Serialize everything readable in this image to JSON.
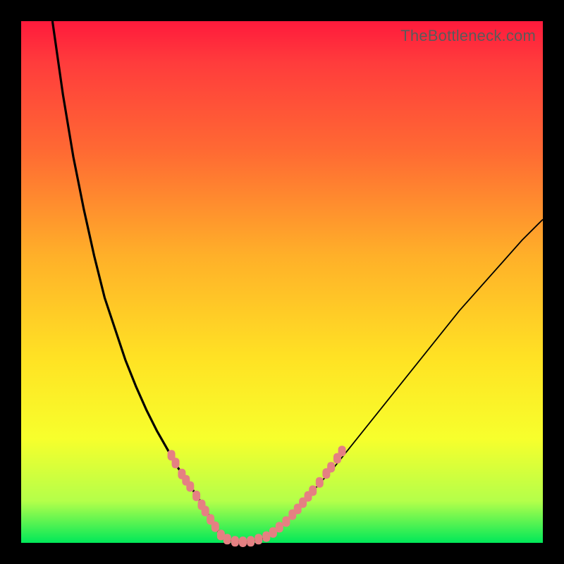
{
  "watermark": "TheBottleneck.com",
  "chart_data": {
    "type": "line",
    "title": "",
    "xlabel": "",
    "ylabel": "",
    "xlim": [
      0,
      100
    ],
    "ylim": [
      0,
      100
    ],
    "series": [
      {
        "name": "left-curve",
        "x": [
          6,
          8,
          10,
          12,
          14,
          16,
          18,
          20,
          22,
          24,
          26,
          28,
          30,
          32,
          34,
          35.5,
          37,
          38.5
        ],
        "y": [
          100,
          86,
          74,
          64,
          55,
          47,
          41,
          35,
          30,
          25.5,
          21.5,
          18,
          14.5,
          11.5,
          8.5,
          6,
          3.5,
          1
        ]
      },
      {
        "name": "valley-floor",
        "x": [
          38.5,
          40,
          42,
          44,
          46,
          47.5
        ],
        "y": [
          1,
          0.4,
          0.2,
          0.3,
          0.7,
          1.4
        ]
      },
      {
        "name": "right-curve",
        "x": [
          47.5,
          50,
          53,
          56,
          60,
          64,
          68,
          72,
          76,
          80,
          84,
          88,
          92,
          96,
          100
        ],
        "y": [
          1.4,
          3.5,
          6.5,
          10,
          14.5,
          19.5,
          24.5,
          29.5,
          34.5,
          39.5,
          44.5,
          49,
          53.5,
          58,
          62
        ]
      }
    ],
    "dot_overlay": {
      "name": "pink-dots",
      "color": "#e58082",
      "points": [
        {
          "x": 28.8,
          "y": 16.8
        },
        {
          "x": 29.6,
          "y": 15.3
        },
        {
          "x": 30.8,
          "y": 13.2
        },
        {
          "x": 31.6,
          "y": 12.0
        },
        {
          "x": 32.4,
          "y": 10.8
        },
        {
          "x": 33.6,
          "y": 9.0
        },
        {
          "x": 34.6,
          "y": 7.3
        },
        {
          "x": 35.3,
          "y": 6.1
        },
        {
          "x": 36.3,
          "y": 4.5
        },
        {
          "x": 37.2,
          "y": 3.1
        },
        {
          "x": 38.3,
          "y": 1.5
        },
        {
          "x": 39.5,
          "y": 0.7
        },
        {
          "x": 41.0,
          "y": 0.3
        },
        {
          "x": 42.5,
          "y": 0.2
        },
        {
          "x": 44.0,
          "y": 0.3
        },
        {
          "x": 45.5,
          "y": 0.7
        },
        {
          "x": 47.0,
          "y": 1.2
        },
        {
          "x": 48.3,
          "y": 2.0
        },
        {
          "x": 49.5,
          "y": 3.0
        },
        {
          "x": 50.8,
          "y": 4.1
        },
        {
          "x": 52.0,
          "y": 5.4
        },
        {
          "x": 53.0,
          "y": 6.5
        },
        {
          "x": 54.0,
          "y": 7.7
        },
        {
          "x": 55.0,
          "y": 8.9
        },
        {
          "x": 55.9,
          "y": 10.0
        },
        {
          "x": 57.2,
          "y": 11.6
        },
        {
          "x": 58.5,
          "y": 13.3
        },
        {
          "x": 59.4,
          "y": 14.5
        },
        {
          "x": 60.6,
          "y": 16.2
        },
        {
          "x": 61.5,
          "y": 17.6
        }
      ]
    },
    "gradient_stops": [
      {
        "pos": 0.0,
        "color": "#ff1a3c"
      },
      {
        "pos": 0.08,
        "color": "#ff3c3c"
      },
      {
        "pos": 0.25,
        "color": "#ff6a33"
      },
      {
        "pos": 0.45,
        "color": "#ffb029"
      },
      {
        "pos": 0.65,
        "color": "#ffe324"
      },
      {
        "pos": 0.8,
        "color": "#f7ff2c"
      },
      {
        "pos": 0.92,
        "color": "#b4ff4a"
      },
      {
        "pos": 1.0,
        "color": "#00e859"
      }
    ]
  }
}
